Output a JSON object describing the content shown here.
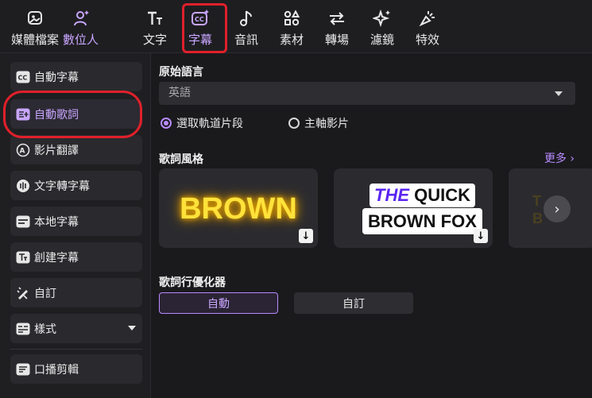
{
  "toolbar": {
    "tabs": [
      {
        "label": "媒體檔案",
        "icon": "media-icon"
      },
      {
        "label": "數位人",
        "icon": "avatar-icon"
      },
      {
        "label": "文字",
        "icon": "text-icon"
      },
      {
        "label": "字幕",
        "icon": "captions-icon"
      },
      {
        "label": "音訊",
        "icon": "music-note-icon"
      },
      {
        "label": "素材",
        "icon": "elements-icon"
      },
      {
        "label": "轉場",
        "icon": "transition-icon"
      },
      {
        "label": "濾鏡",
        "icon": "filter-icon"
      },
      {
        "label": "特效",
        "icon": "effects-icon"
      }
    ],
    "active_tab": "字幕"
  },
  "sidebar": {
    "items": [
      {
        "label": "自動字幕",
        "icon": "cc-icon"
      },
      {
        "label": "自動歌詞",
        "icon": "auto-lyrics-icon"
      },
      {
        "label": "影片翻譯",
        "icon": "translate-icon"
      },
      {
        "label": "文字轉字幕",
        "icon": "text-to-speech-icon"
      },
      {
        "label": "本地字幕",
        "icon": "local-subtitle-icon"
      },
      {
        "label": "創建字幕",
        "icon": "create-subtitle-icon"
      },
      {
        "label": "自訂",
        "icon": "custom-icon"
      },
      {
        "label": "樣式",
        "icon": "style-icon"
      },
      {
        "label": "口播剪輯",
        "icon": "speech-edit-icon"
      }
    ],
    "active_item": "自動歌詞"
  },
  "main": {
    "original_language": {
      "title": "原始語言",
      "selected": "英語"
    },
    "source": {
      "options": [
        "選取軌道片段",
        "主軸影片"
      ],
      "selected": "選取軌道片段"
    },
    "lyric_style": {
      "title": "歌詞風格",
      "more_label": "更多",
      "cards": [
        {
          "text": "BROWN"
        },
        {
          "line1_a": "THE",
          "line1_b": "QUICK",
          "line2": "BROWN FOX"
        },
        {
          "text": "T\nB"
        }
      ]
    },
    "optimizer": {
      "title": "歌詞行優化器",
      "options": [
        "自動",
        "自訂"
      ],
      "selected": "自動"
    }
  },
  "colors": {
    "accent": "#b98bff",
    "highlight_annotation": "#e0202a",
    "background": "#1a1a1d"
  }
}
